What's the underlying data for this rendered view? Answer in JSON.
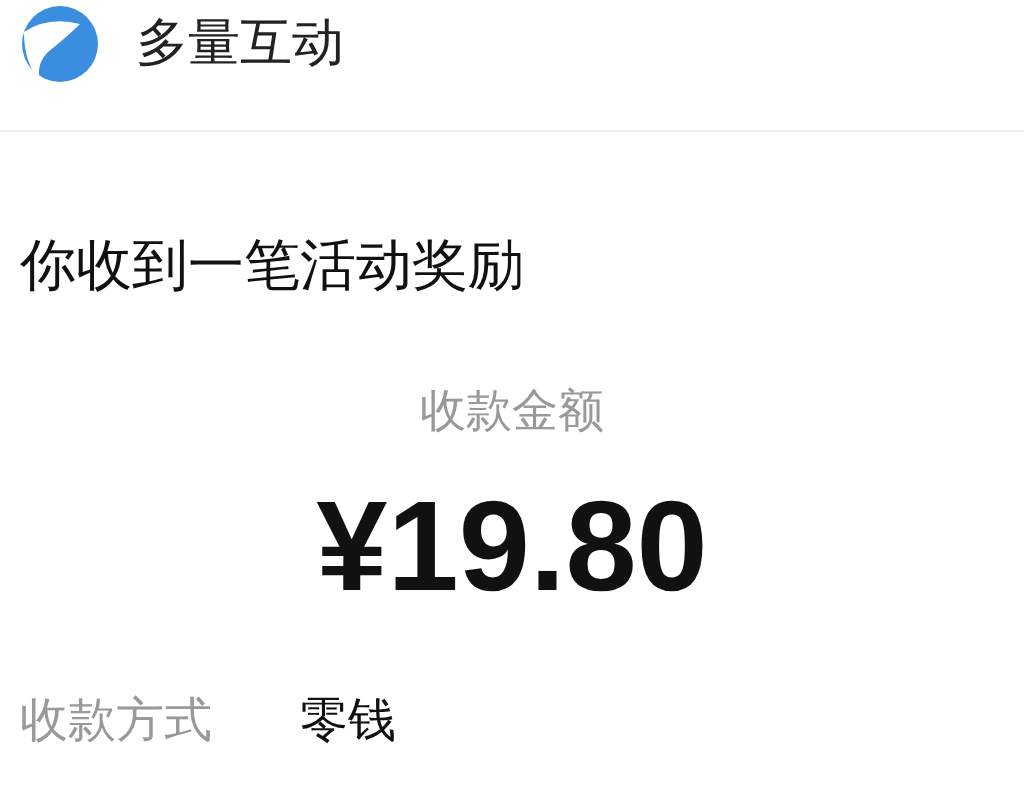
{
  "header": {
    "app_name": "多量互动"
  },
  "message": {
    "title": "你收到一笔活动奖励",
    "amount_label": "收款金额",
    "amount": "¥19.80",
    "details": [
      {
        "label": "收款方式",
        "value": "零钱"
      }
    ]
  }
}
